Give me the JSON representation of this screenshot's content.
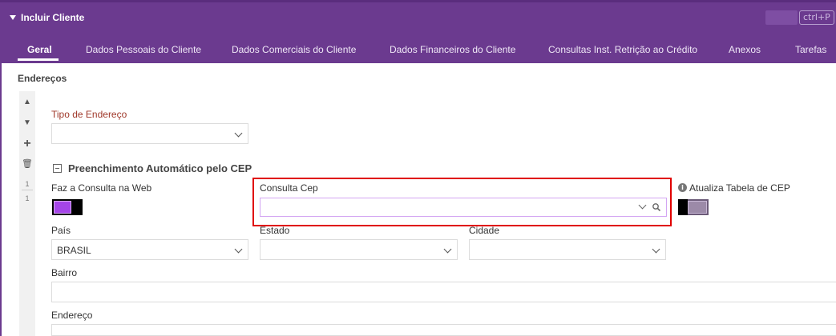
{
  "header": {
    "title": "Incluir Cliente",
    "shortcut": "ctrl+P"
  },
  "tabs": [
    {
      "label": "Geral",
      "active": true
    },
    {
      "label": "Dados Pessoais do Cliente"
    },
    {
      "label": "Dados Comerciais do Cliente"
    },
    {
      "label": "Dados Financeiros do Cliente"
    },
    {
      "label": "Consultas Inst. Retrição ao Crédito"
    },
    {
      "label": "Anexos"
    },
    {
      "label": "Tarefas"
    }
  ],
  "section": {
    "title": "Endereços"
  },
  "rail": {
    "up": "▲",
    "down": "▼",
    "add": "+",
    "delete": "🗑",
    "page_current": "1",
    "page_total": "1"
  },
  "form": {
    "tipo_endereco": {
      "label": "Tipo de Endereço",
      "value": ""
    },
    "group_title": "Preenchimento Automático pelo CEP",
    "consulta_web": {
      "label": "Faz a Consulta na Web",
      "on": true
    },
    "consulta_cep": {
      "label": "Consulta Cep",
      "value": ""
    },
    "atualiza_cep": {
      "label": "Atualiza Tabela de CEP",
      "on": false,
      "info": "i"
    },
    "pais": {
      "label": "País",
      "value": "BRASIL"
    },
    "estado": {
      "label": "Estado",
      "value": ""
    },
    "cidade": {
      "label": "Cidade",
      "value": ""
    },
    "bairro": {
      "label": "Bairro",
      "value": ""
    },
    "endereco": {
      "label": "Endereço",
      "value": ""
    }
  },
  "colors": {
    "header": "#6b3a8f",
    "accent": "#a545e8",
    "highlight": "#e00000",
    "required": "#a0392b"
  }
}
